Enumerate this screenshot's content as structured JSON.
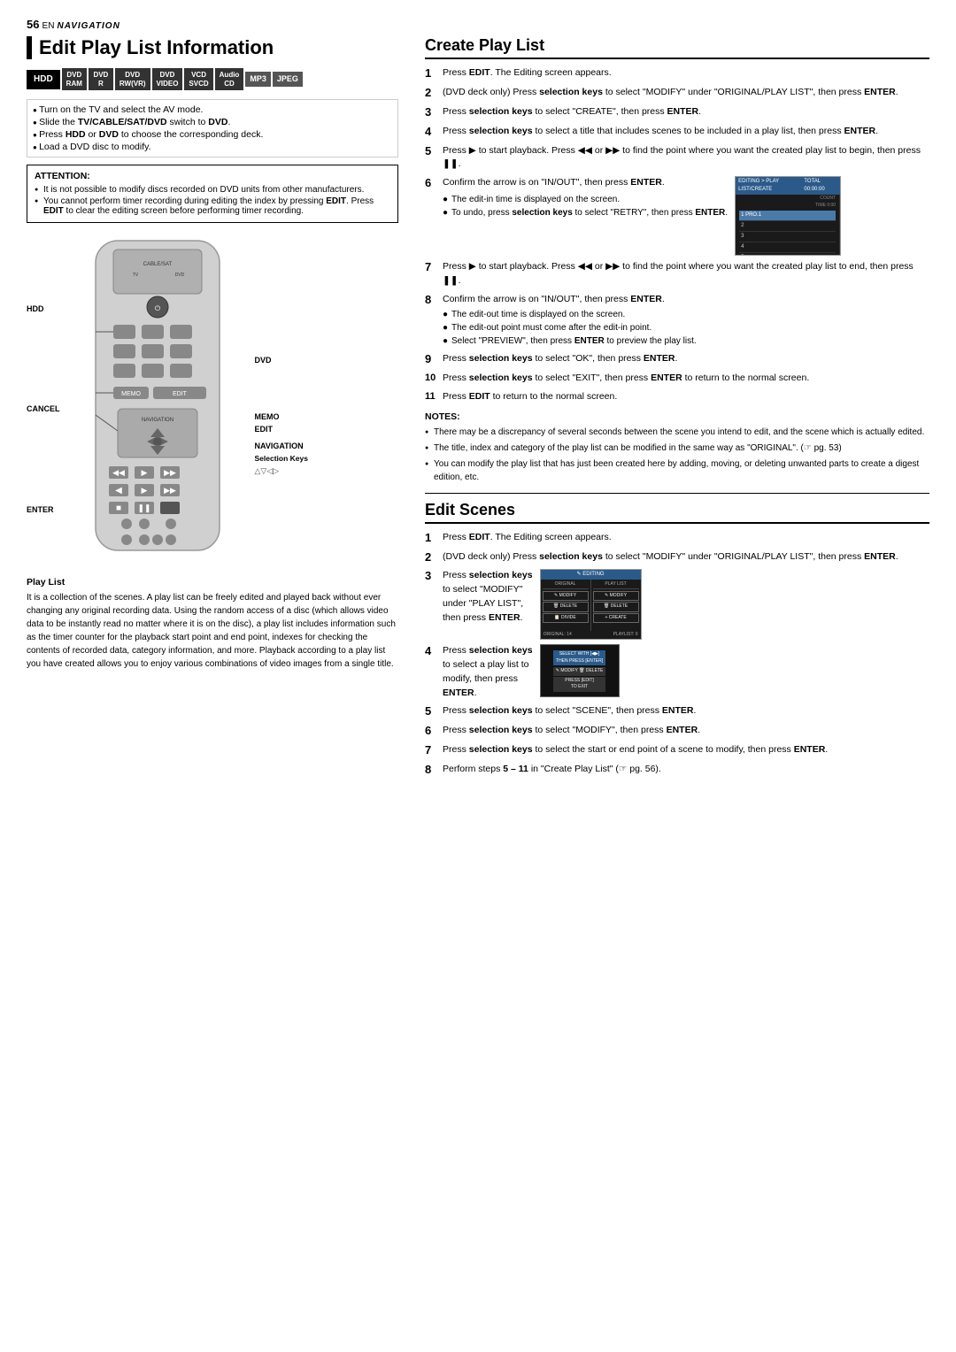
{
  "header": {
    "page_number": "56",
    "lang": "EN",
    "section": "NAVIGATION"
  },
  "left": {
    "main_title": "Edit Play List Information",
    "badges": [
      {
        "id": "hdd",
        "label": "HDD",
        "class": "badge-hdd"
      },
      {
        "id": "dvd-ram",
        "label1": "DVD",
        "label2": "RAM",
        "class": "badge-dvd-ram"
      },
      {
        "id": "dvd-r",
        "label1": "DVD",
        "label2": "R",
        "class": "badge-dvd-r"
      },
      {
        "id": "dvd-rw",
        "label1": "DVD",
        "label2": "RW(VR)",
        "class": "badge-dvd-rw"
      },
      {
        "id": "dvd-video",
        "label1": "DVD",
        "label2": "VIDEO",
        "class": "badge-dvd-video"
      },
      {
        "id": "vcd",
        "label1": "VCD",
        "label2": "SVCD",
        "class": "badge-vcd"
      },
      {
        "id": "audio",
        "label1": "Audio",
        "label2": "CD",
        "class": "badge-audio"
      },
      {
        "id": "mp3",
        "label": "MP3",
        "class": "badge-mp3"
      },
      {
        "id": "jpeg",
        "label": "JPEG",
        "class": "badge-jpeg"
      }
    ],
    "bullet_items": [
      "Turn on the TV and select the AV mode.",
      "Slide the TV/CABLE/SAT/DVD switch to DVD.",
      "Press HDD or DVD to choose the corresponding deck.",
      "Load a DVD disc to modify."
    ],
    "attention": {
      "title": "ATTENTION:",
      "items": [
        "It is not possible to modify discs recorded on DVD units from other manufacturers.",
        "You cannot perform timer recording during editing the index by pressing EDIT. Press EDIT to clear the editing screen before performing timer recording."
      ]
    },
    "remote_labels": {
      "left": [
        "HDD",
        "CANCEL",
        "ENTER"
      ],
      "right": [
        "DVD",
        "MEMO",
        "EDIT",
        "NAVIGATION",
        "Selection Keys"
      ]
    },
    "playlist_section": {
      "title": "Play List",
      "text": "It is a collection of the scenes. A play list can be freely edited and played back without ever changing any original recording data. Using the random access of a disc (which allows video data to be instantly read no matter where it is on the disc), a play list includes information such as the timer counter for the playback start point and end point, indexes for checking the contents of recorded data, category information, and more. Playback according to a play list you have created allows you to enjoy various combinations of video images from a single title."
    }
  },
  "right": {
    "create_playlist": {
      "title": "Create Play List",
      "steps": [
        {
          "num": "1",
          "text": "Press EDIT. The Editing screen appears."
        },
        {
          "num": "2",
          "text": "(DVD deck only) Press selection keys to select \"MODIFY\" under \"ORIGINAL/PLAY LIST\", then press ENTER."
        },
        {
          "num": "3",
          "text": "Press selection keys to select \"CREATE\", then press ENTER."
        },
        {
          "num": "4",
          "text": "Press selection keys to select a title that includes scenes to be included in a play list, then press ENTER."
        },
        {
          "num": "5",
          "text": "Press ▶ to start playback. Press ◀◀ or ▶▶ to find the point where you want the created play list to begin, then press ❚❚."
        },
        {
          "num": "6",
          "text": "Confirm the arrow is on \"IN/OUT\", then press ENTER.",
          "has_image": true,
          "sub_bullets": [
            "The edit-in time is displayed on the screen.",
            "To undo, press selection keys to select \"RETRY\", then press ENTER."
          ]
        },
        {
          "num": "7",
          "text": "Press ▶ to start playback. Press ◀◀ or ▶▶ to find the point where you want the created play list to end, then press ❚❚."
        },
        {
          "num": "8",
          "text": "Confirm the arrow is on \"IN/OUT\", then press ENTER.",
          "sub_bullets": [
            "The edit-out time is displayed on the screen.",
            "The edit-out point must come after the edit-in point.",
            "Select \"PREVIEW\", then press ENTER to preview the play list."
          ]
        },
        {
          "num": "9",
          "text": "Press selection keys to select \"OK\", then press ENTER."
        },
        {
          "num": "10",
          "text": "Press selection keys to select \"EXIT\", then press ENTER to return to the normal screen."
        },
        {
          "num": "11",
          "text": "Press EDIT to return to the normal screen."
        }
      ],
      "notes": {
        "title": "NOTES:",
        "items": [
          "There may be a discrepancy of several seconds between the scene you intend to edit, and the scene which is actually edited.",
          "The title, index and category of the play list can be modified in the same way as \"ORIGINAL\". (☞ pg. 53)",
          "You can modify the play list that has just been created here by adding, moving, or deleting unwanted parts to create a digest edition, etc."
        ]
      }
    },
    "edit_scenes": {
      "title": "Edit Scenes",
      "steps": [
        {
          "num": "1",
          "text": "Press EDIT. The Editing screen appears."
        },
        {
          "num": "2",
          "text": "(DVD deck only) Press selection keys to select \"MODIFY\" under \"ORIGINAL/PLAY LIST\", then press ENTER."
        },
        {
          "num": "3",
          "text": "Press selection keys to select \"MODIFY\" under \"PLAY LIST\", then press ENTER.",
          "has_image": true
        },
        {
          "num": "4",
          "text": "Press selection keys to select a play list to modify, then press ENTER.",
          "has_image": true
        },
        {
          "num": "5",
          "text": "Press selection keys to select \"SCENE\", then press ENTER."
        },
        {
          "num": "6",
          "text": "Press selection keys to select \"MODIFY\", then press ENTER."
        },
        {
          "num": "7",
          "text": "Press selection keys to select the start or end point of a scene to modify, then press ENTER."
        },
        {
          "num": "8",
          "text": "Perform steps 5 – 11 in \"Create Play List\" (☞ pg. 56)."
        }
      ]
    }
  }
}
